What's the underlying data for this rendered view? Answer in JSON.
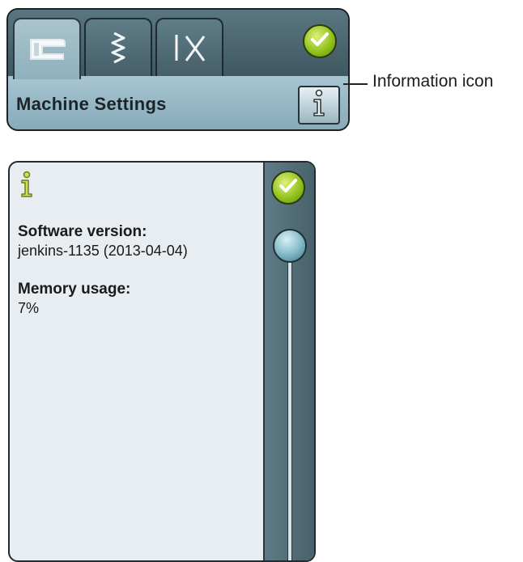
{
  "header": {
    "tabs": [
      {
        "name": "sewing-machine-tab",
        "icon": "sewing-machine-icon",
        "active": true
      },
      {
        "name": "stitch-tab",
        "icon": "zigzag-stitch-icon",
        "active": false
      },
      {
        "name": "tools-tab",
        "icon": "needle-scissors-icon",
        "active": false
      }
    ],
    "title": "Machine Settings",
    "confirm_icon": "checkmark-icon",
    "info_icon": "information-icon"
  },
  "callout": {
    "label": "Information icon"
  },
  "info_dialog": {
    "icon": "information-icon",
    "software_label": "Software version:",
    "software_value": "jenkins-1135 (2013-04-04)",
    "memory_label": "Memory usage:",
    "memory_value": "7%",
    "scroll_position": 0
  },
  "colors": {
    "panel": "#4f6a74",
    "title_bar": "#a8c5d2",
    "dialog_bg": "#e7edf1",
    "confirm_green": "#8cbf1a",
    "info_icon_yellow": "#b8d23c"
  }
}
